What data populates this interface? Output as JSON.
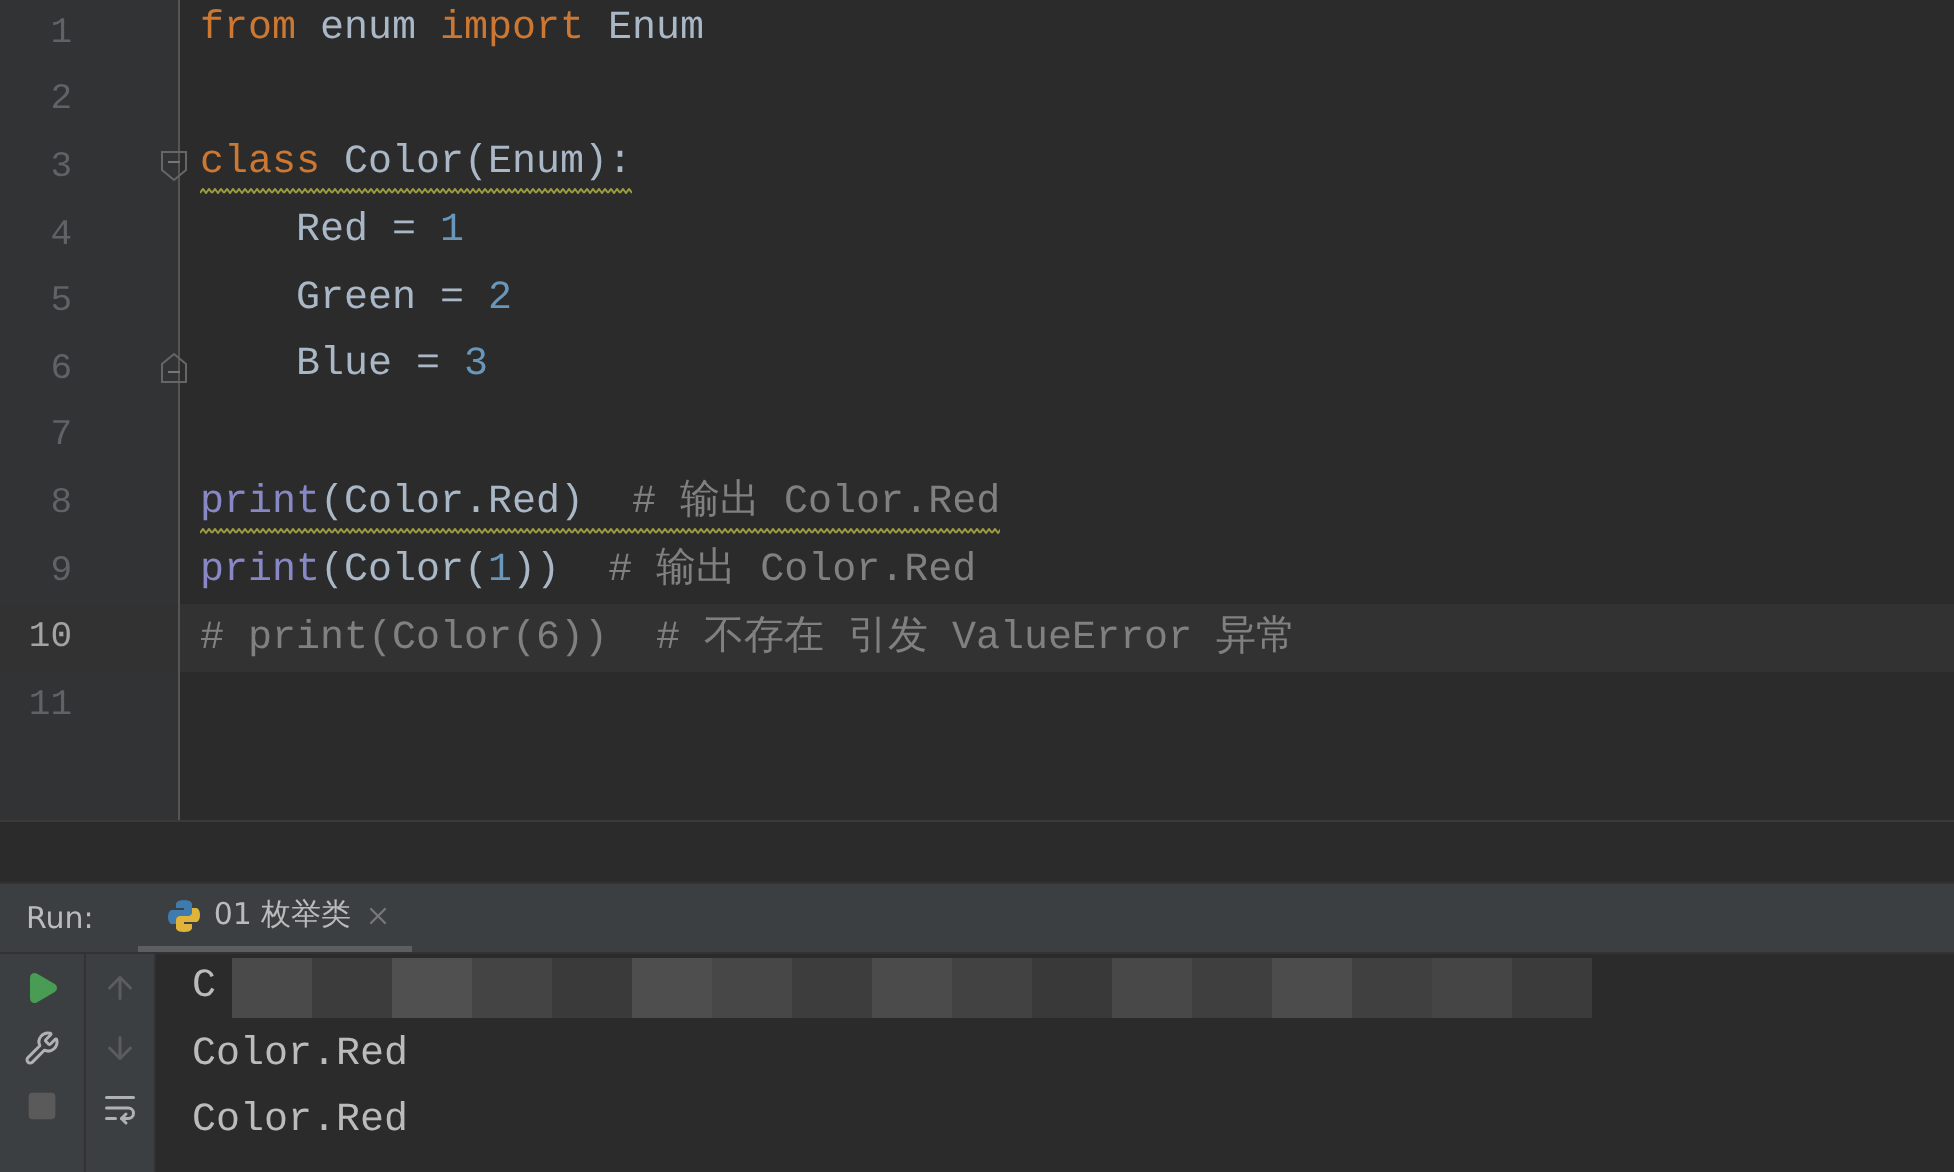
{
  "editor": {
    "lines": [
      {
        "number": "1",
        "current": false,
        "kind": "plain",
        "warned": false,
        "tokens": [
          {
            "kind": "keyword",
            "text": "from"
          },
          {
            "kind": "name",
            "text": " enum "
          },
          {
            "kind": "keyword",
            "text": "import"
          },
          {
            "kind": "name",
            "text": " Enum"
          }
        ]
      },
      {
        "number": "2",
        "current": false,
        "kind": "plain"
      },
      {
        "number": "3",
        "current": false,
        "kind": "fold-start",
        "warned": true,
        "tokens": [
          {
            "kind": "keyword",
            "text": "class"
          },
          {
            "kind": "name",
            "text": " Color(Enum):"
          }
        ]
      },
      {
        "number": "4",
        "current": false,
        "kind": "plain",
        "warned": false,
        "tokens": [
          {
            "kind": "name",
            "text": "    Red = "
          },
          {
            "kind": "number",
            "text": "1"
          }
        ]
      },
      {
        "number": "5",
        "current": false,
        "kind": "plain",
        "warned": false,
        "tokens": [
          {
            "kind": "name",
            "text": "    Green = "
          },
          {
            "kind": "number",
            "text": "2"
          }
        ]
      },
      {
        "number": "6",
        "current": false,
        "kind": "fold-end",
        "warned": false,
        "tokens": [
          {
            "kind": "name",
            "text": "    Blue = "
          },
          {
            "kind": "number",
            "text": "3"
          }
        ]
      },
      {
        "number": "7",
        "current": false,
        "kind": "plain"
      },
      {
        "number": "8",
        "current": false,
        "kind": "plain",
        "warned": true,
        "tokens": [
          {
            "kind": "builtin",
            "text": "print"
          },
          {
            "kind": "name",
            "text": "(Color.Red)  "
          },
          {
            "kind": "comment",
            "text": "# 输出 Color.Red"
          }
        ]
      },
      {
        "number": "9",
        "current": false,
        "kind": "plain",
        "warned": false,
        "tokens": [
          {
            "kind": "builtin",
            "text": "print"
          },
          {
            "kind": "name",
            "text": "(Color("
          },
          {
            "kind": "number",
            "text": "1"
          },
          {
            "kind": "name",
            "text": "))  "
          },
          {
            "kind": "comment",
            "text": "# 输出 Color.Red"
          }
        ]
      },
      {
        "number": "10",
        "current": true,
        "kind": "plain",
        "warned": false,
        "tokens": [
          {
            "kind": "comment",
            "text": "# print(Color(6))  # 不存在 引发 ValueError 异常"
          }
        ]
      },
      {
        "number": "11",
        "current": false,
        "kind": "plain"
      }
    ]
  },
  "run": {
    "label": "Run:",
    "tabs": [
      {
        "label": "01 枚举类",
        "selected": true
      }
    ],
    "output": [
      {
        "text": "C",
        "blurred": true
      },
      {
        "text": "Color.Red"
      },
      {
        "text": "Color.Red"
      }
    ]
  }
}
